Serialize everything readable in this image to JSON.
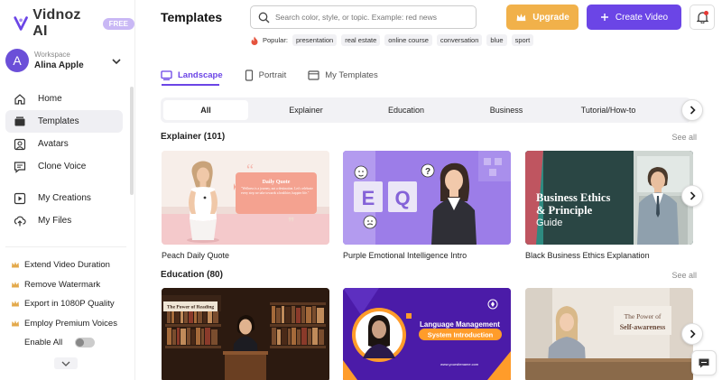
{
  "brand": {
    "name": "Vidnoz AI",
    "badge": "FREE"
  },
  "workspace": {
    "label": "Workspace",
    "user_name": "Alina Apple",
    "avatar_letter": "A"
  },
  "nav": {
    "items": [
      {
        "label": "Home",
        "icon": "home-icon"
      },
      {
        "label": "Templates",
        "icon": "templates-icon"
      },
      {
        "label": "Avatars",
        "icon": "avatars-icon"
      },
      {
        "label": "Clone Voice",
        "icon": "clone-voice-icon"
      },
      {
        "label": "My Creations",
        "icon": "creations-icon"
      },
      {
        "label": "My Files",
        "icon": "files-icon"
      }
    ],
    "active": "Templates"
  },
  "perks": [
    {
      "label": "Extend Video Duration",
      "icon": "crown-icon"
    },
    {
      "label": "Remove Watermark",
      "icon": "crown-icon"
    },
    {
      "label": "Export in 1080P Quality",
      "icon": "crown-icon"
    },
    {
      "label": "Employ Premium Voices",
      "icon": "crown-icon"
    }
  ],
  "enable_all": {
    "label": "Enable All",
    "on": false
  },
  "header": {
    "title": "Templates",
    "search_placeholder": "Search color, style, or topic. Example: red news",
    "popular_label": "Popular:",
    "popular_tags": [
      "presentation",
      "real estate",
      "online course",
      "conversation",
      "blue",
      "sport"
    ],
    "upgrade_label": "Upgrade",
    "create_label": "Create Video"
  },
  "orientation_tabs": [
    {
      "label": "Landscape",
      "icon": "landscape-icon"
    },
    {
      "label": "Portrait",
      "icon": "portrait-icon"
    },
    {
      "label": "My Templates",
      "icon": "my-templates-icon"
    }
  ],
  "orientation_active": "Landscape",
  "categories": [
    "All",
    "Explainer",
    "Education",
    "Business",
    "Tutorial/How-to"
  ],
  "category_active": "All",
  "sections": [
    {
      "title": "Explainer (101)",
      "see_all": "See all",
      "cards": [
        {
          "title": "Peach Daily Quote",
          "heading": "Daily Quote",
          "body": "\"Wellness is a journey, not a destination. Let's celebrate every step we take towards a healthier, happier life.\""
        },
        {
          "title": "Purple Emotional Intelligence Intro",
          "letters": "EQ"
        },
        {
          "title": "Black Business Ethics Explanation",
          "line1": "Business Ethics",
          "line2": "& Principle",
          "line3": "Guide"
        }
      ]
    },
    {
      "title": "Education (80)",
      "see_all": "See all",
      "cards": [
        {
          "sign": "The Power of Reading"
        },
        {
          "line1": "Language Management",
          "line2": "System Introduction",
          "url": "www.yoursitename.com"
        },
        {
          "line1": "The Power of",
          "line2": "Self-awareness"
        }
      ]
    }
  ],
  "colors": {
    "accent": "#6b45e6",
    "upgrade": "#f1b14a",
    "notification": "#e53935"
  }
}
